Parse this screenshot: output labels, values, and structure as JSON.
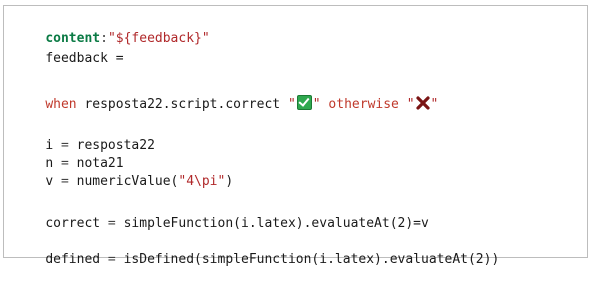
{
  "code": {
    "line1": {
      "key": "content",
      "colon": ":",
      "value": "\"${feedback}\""
    },
    "line2": {
      "text": "feedback ="
    },
    "line3": {
      "when": "when",
      "expr": " resposta22.script.correct ",
      "q1": "\"",
      "check_icon": "green-check-icon",
      "q2": "\"",
      "otherwise": " otherwise ",
      "q3": "\"",
      "x_icon": "red-x-icon",
      "q4": "\""
    },
    "line4": {
      "lhs": "i",
      "eq": " = ",
      "rhs": "resposta22"
    },
    "line5": {
      "lhs": "n",
      "eq": " = ",
      "rhs": "nota21"
    },
    "line6": {
      "lhs": "v",
      "eq": " = ",
      "fn": "numericValue(",
      "arg": "\"4\\pi\"",
      "close": ")"
    },
    "line7": {
      "lhs": "correct",
      "eq": " = ",
      "rhs": "simpleFunction(i.latex).evaluateAt(2)=v"
    },
    "line8": {
      "lhs": "defined",
      "eq": " = ",
      "rhs": "isDefined(simpleFunction(i.latex).evaluateAt(2))"
    }
  }
}
